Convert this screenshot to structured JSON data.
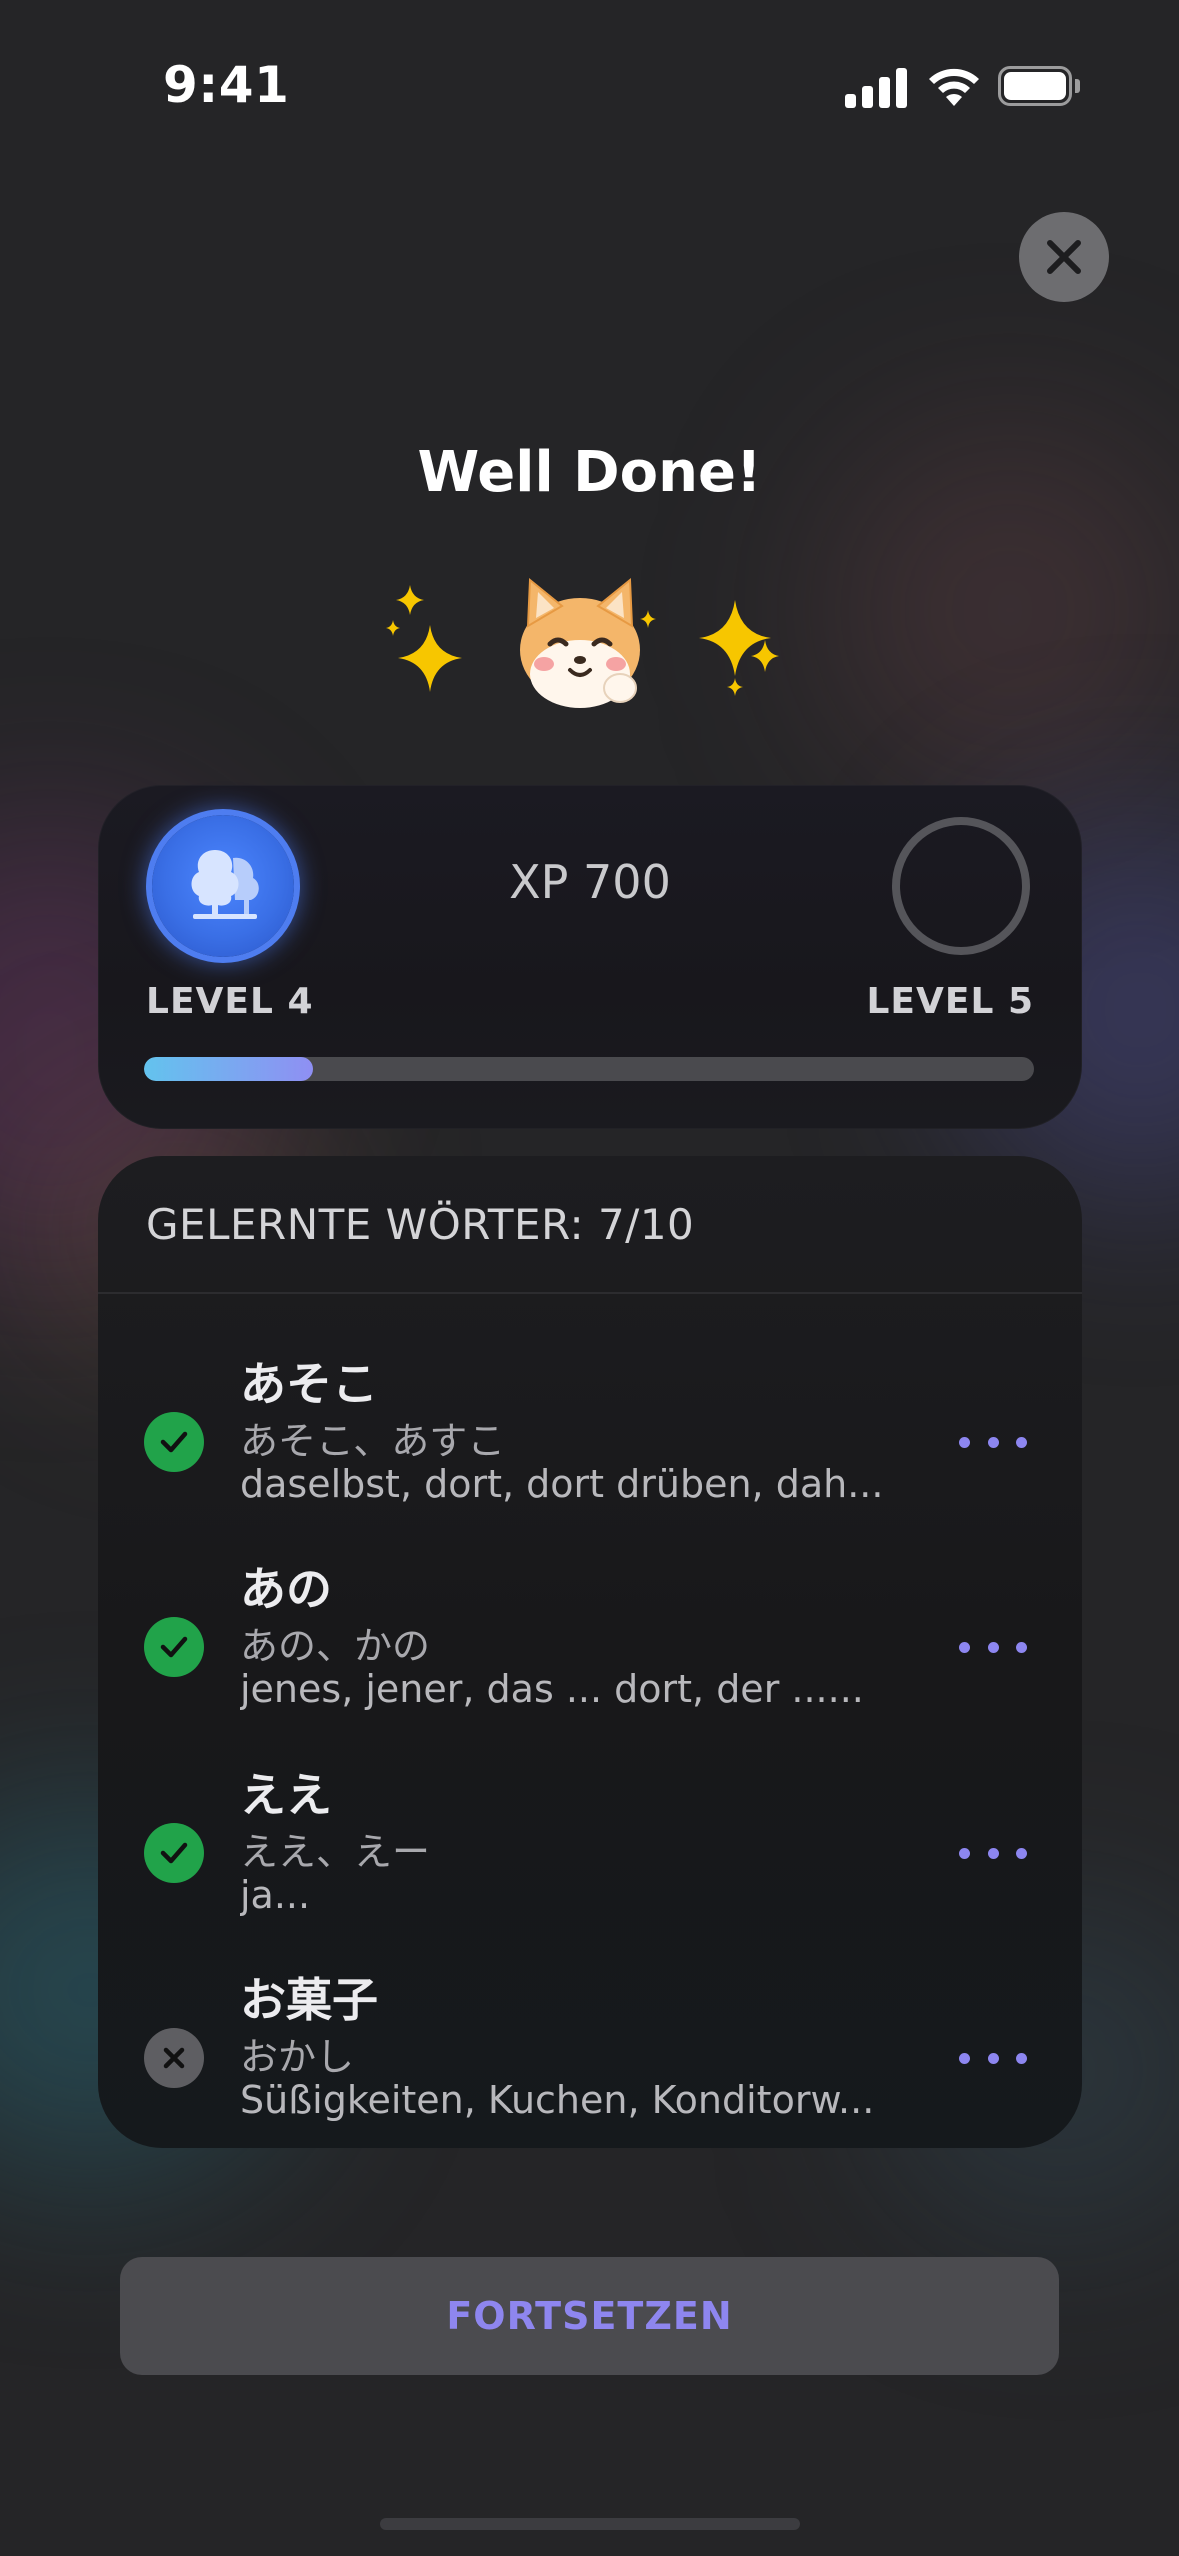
{
  "status_bar": {
    "time": "9:41"
  },
  "header": {
    "title": "Well Done!"
  },
  "level": {
    "xp_label": "XP 700",
    "current_label": "LEVEL 4",
    "next_label": "LEVEL 5",
    "progress_fraction": 0.19
  },
  "words": {
    "header": "GELERNTE WÖRTER: 7/10",
    "items": [
      {
        "word": "あそこ",
        "reading": "あそこ、あすこ",
        "meaning": "daselbst, dort, dort drüben, dah...",
        "learned": true
      },
      {
        "word": "あの",
        "reading": "あの、かの",
        "meaning": "jenes, jener, das ... dort, der ......",
        "learned": true
      },
      {
        "word": "ええ",
        "reading": "ええ、えー",
        "meaning": "ja...",
        "learned": true
      },
      {
        "word": "お菓子",
        "reading": "おかし",
        "meaning": "Süßigkeiten, Kuchen, Konditorw...",
        "learned": false
      }
    ]
  },
  "footer": {
    "continue_label": "FORTSETZEN"
  },
  "colors": {
    "accent": "#8e86ef",
    "success": "#21a34a",
    "level_blue": "#3a6fe6"
  },
  "icons": [
    "signal-icon",
    "wifi-icon",
    "battery-icon",
    "close-icon",
    "sparkles-icon",
    "shiba-dog-icon",
    "trees-icon",
    "check-icon",
    "x-icon",
    "more-icon"
  ]
}
